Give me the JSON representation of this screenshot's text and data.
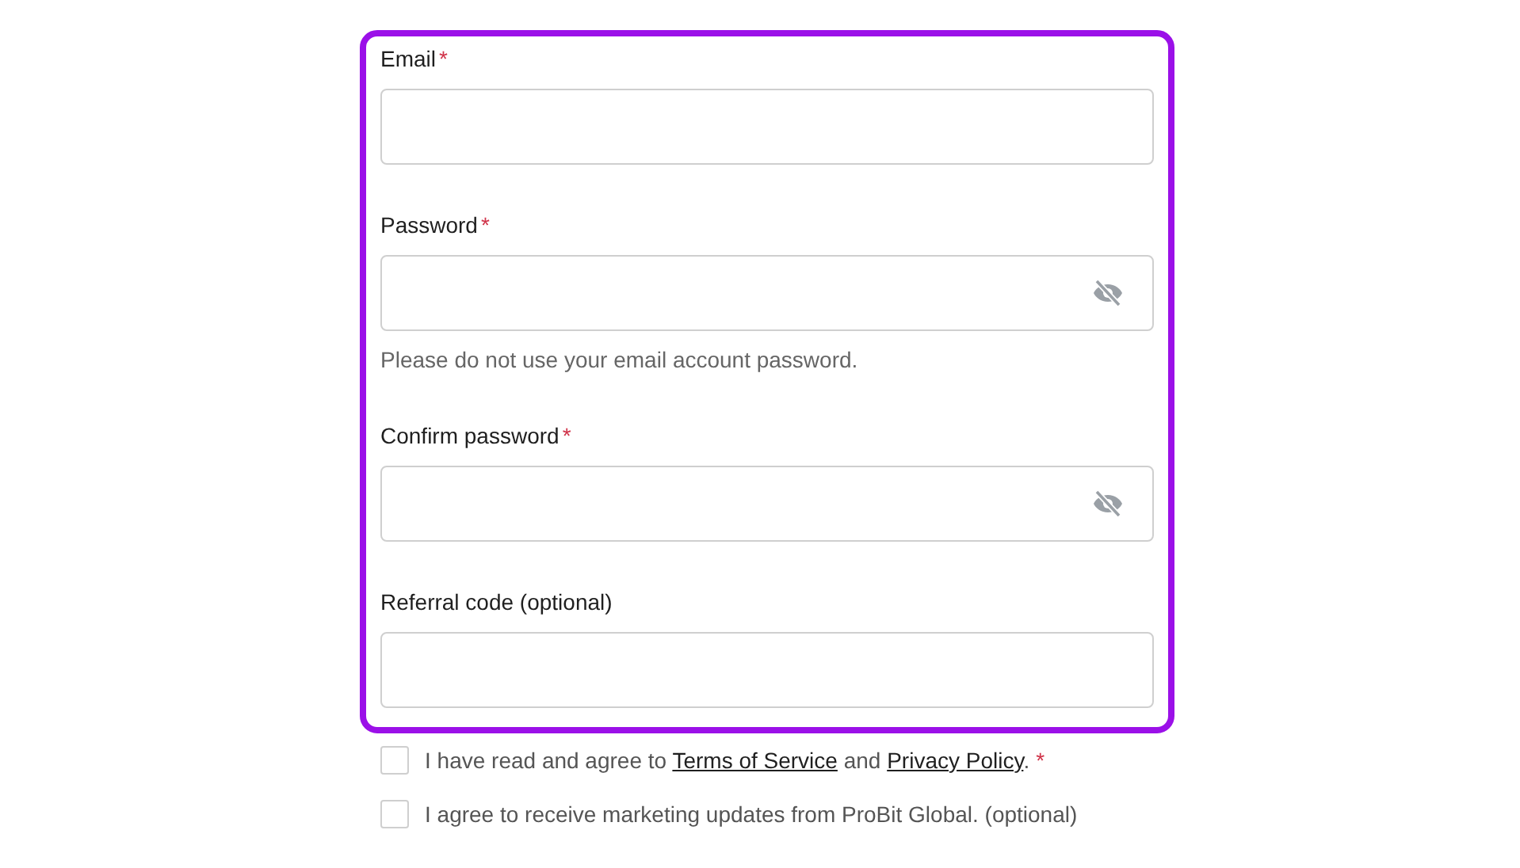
{
  "form": {
    "fields": [
      {
        "label": "Email",
        "required_mark": "*",
        "kind": "text"
      },
      {
        "label": "Password",
        "required_mark": "*",
        "kind": "password",
        "hint": "Please do not use your email account password."
      },
      {
        "label": "Confirm password",
        "required_mark": "*",
        "kind": "password"
      },
      {
        "label": "Referral code (optional)",
        "kind": "text"
      }
    ]
  },
  "agreements": [
    {
      "checked": false,
      "parts": [
        {
          "kind": "text",
          "text": "I have read and agree to "
        },
        {
          "kind": "link",
          "text": "Terms of Service"
        },
        {
          "kind": "text",
          "text": " and "
        },
        {
          "kind": "link",
          "text": "Privacy Policy"
        },
        {
          "kind": "text",
          "text": "."
        }
      ],
      "required_mark": "*"
    },
    {
      "checked": false,
      "parts": [
        {
          "kind": "text",
          "text": "I agree to receive marketing updates from ProBit Global. (optional)"
        }
      ]
    }
  ]
}
